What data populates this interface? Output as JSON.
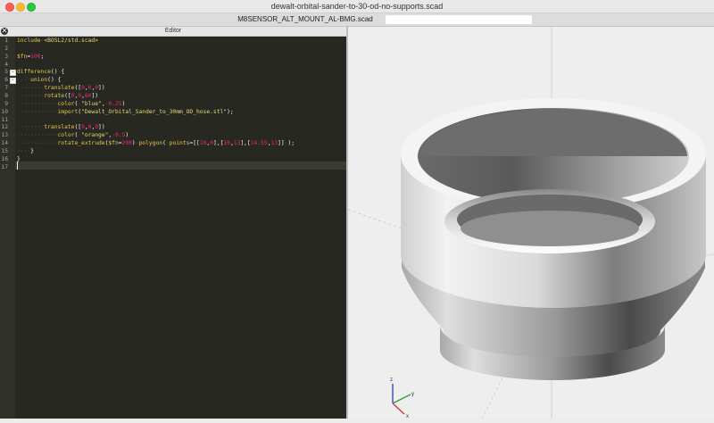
{
  "window": {
    "title": "dewalt-orbital-sander-to-30-od-no-supports.scad"
  },
  "tabs": {
    "active_label": "M8SENSOR_ALT_MOUNT_AL-BMG.scad"
  },
  "editor": {
    "title": "Editor",
    "lines": [
      {
        "n": "1",
        "text": "include <BOSL2/std.scad>"
      },
      {
        "n": "2",
        "text": ""
      },
      {
        "n": "3",
        "text": "$fn=100;"
      },
      {
        "n": "4",
        "text": ""
      },
      {
        "n": "5",
        "text": "difference() {"
      },
      {
        "n": "6",
        "text": "    union() {"
      },
      {
        "n": "7",
        "text": "        translate([0,0,0])"
      },
      {
        "n": "8",
        "text": "        rotate([0,0,60])"
      },
      {
        "n": "9",
        "text": "            color( \"blue\", 0.25)"
      },
      {
        "n": "10",
        "text": "            import(\"Dewalt_Orbital_Sander_to_30mm_OD_hose.stl\");"
      },
      {
        "n": "11",
        "text": ""
      },
      {
        "n": "12",
        "text": "        translate([0,0,0])"
      },
      {
        "n": "13",
        "text": "            color( \"orange\", 0.5)"
      },
      {
        "n": "14",
        "text": "            rotate_extrude($fn=200) polygon( points=[[10,0],[10,13],[14.55,13]] );"
      },
      {
        "n": "15",
        "text": "    }"
      },
      {
        "n": "16",
        "text": "}"
      },
      {
        "n": "17",
        "text": ""
      }
    ]
  },
  "viewport": {
    "axis_labels": {
      "x": "x",
      "y": "y",
      "z": "z"
    },
    "axis_colors": {
      "x": "#d03030",
      "y": "#2fa02f",
      "z": "#2040d0"
    }
  },
  "colors": {
    "editor_bg": "#272822",
    "keyword": "#66d9ef",
    "string": "#e6db74",
    "number": "#f92672",
    "call": "#e6c84a",
    "text": "#f8f8f2",
    "whitespace_dot": "#5d5d52"
  }
}
